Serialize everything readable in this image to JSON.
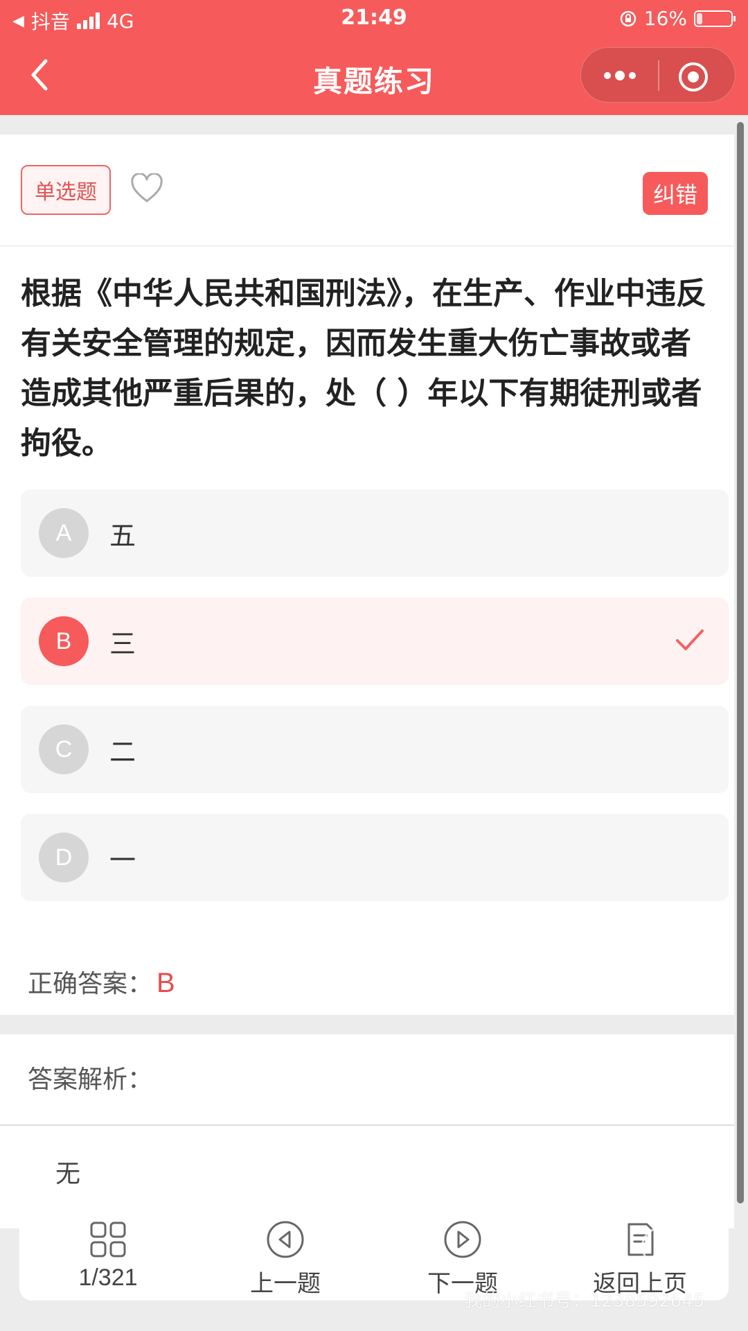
{
  "status_bar": {
    "back_app": "抖音",
    "network": "4G",
    "time": "21:49",
    "battery": "16%",
    "battery_level": 0.16
  },
  "nav": {
    "title": "真题练习"
  },
  "question": {
    "type": "单选题",
    "correct_error_label": "纠错",
    "text": "根据《中华人民共和国刑法》，在生产、作业中违反有关安全管理的规定，因而发生重大伤亡事故或者造成其他严重后果的，处（ ）年以下有期徒刑或者拘役。",
    "options": [
      {
        "letter": "A",
        "text": "五"
      },
      {
        "letter": "B",
        "text": "三"
      },
      {
        "letter": "C",
        "text": "二"
      },
      {
        "letter": "D",
        "text": "一"
      }
    ],
    "selected": "B",
    "answer_label": "正确答案：",
    "answer_value": "B"
  },
  "analysis": {
    "label": "答案解析：",
    "content": "无"
  },
  "bottom_nav": {
    "progress": "1/321",
    "prev": "上一题",
    "next": "下一题",
    "back": "返回上页"
  },
  "watermark": {
    "text": "我的小红书号：1238592645",
    "logo": "小红书"
  },
  "colors": {
    "accent": "#f75a5a",
    "selected_bg": "#fff2f2",
    "option_bg": "#f6f6f6"
  }
}
